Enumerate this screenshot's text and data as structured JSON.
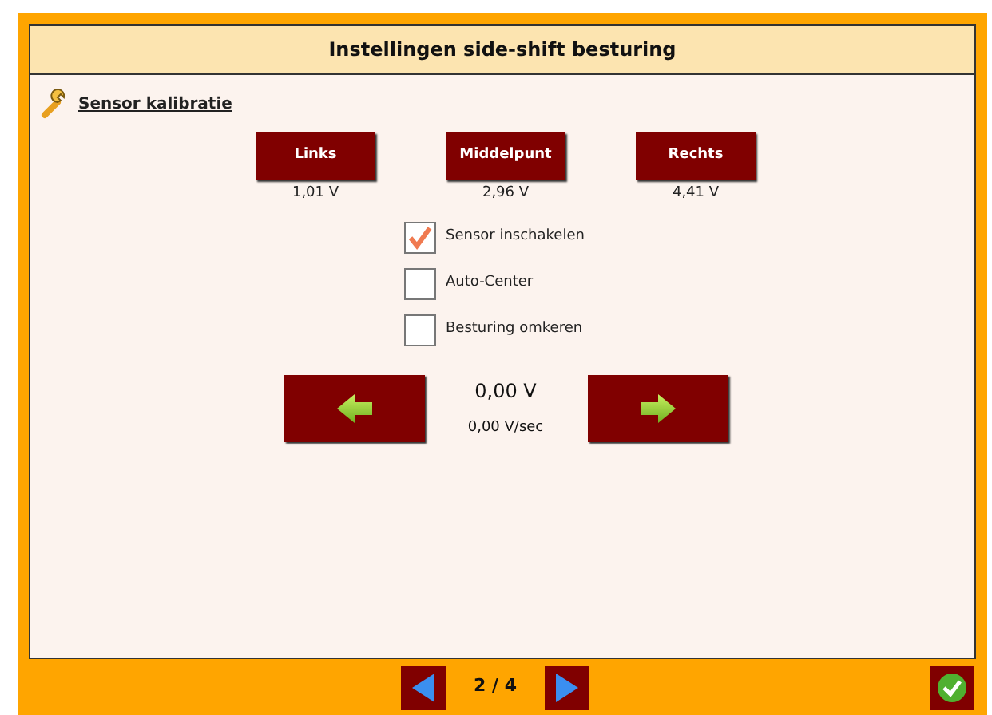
{
  "title": "Instellingen side-shift besturing",
  "section_link": "Sensor kalibratie",
  "calibration": [
    {
      "label": "Links",
      "reading": "1,01 V"
    },
    {
      "label": "Middelpunt",
      "reading": "2,96 V"
    },
    {
      "label": "Rechts",
      "reading": "4,41 V"
    }
  ],
  "options": [
    {
      "label": "Sensor inschakelen",
      "checked": true
    },
    {
      "label": "Auto-Center",
      "checked": false
    },
    {
      "label": "Besturing omkeren",
      "checked": false
    }
  ],
  "voltage": "0,00 V",
  "rate": "0,00 V/sec",
  "pager": "2 / 4"
}
